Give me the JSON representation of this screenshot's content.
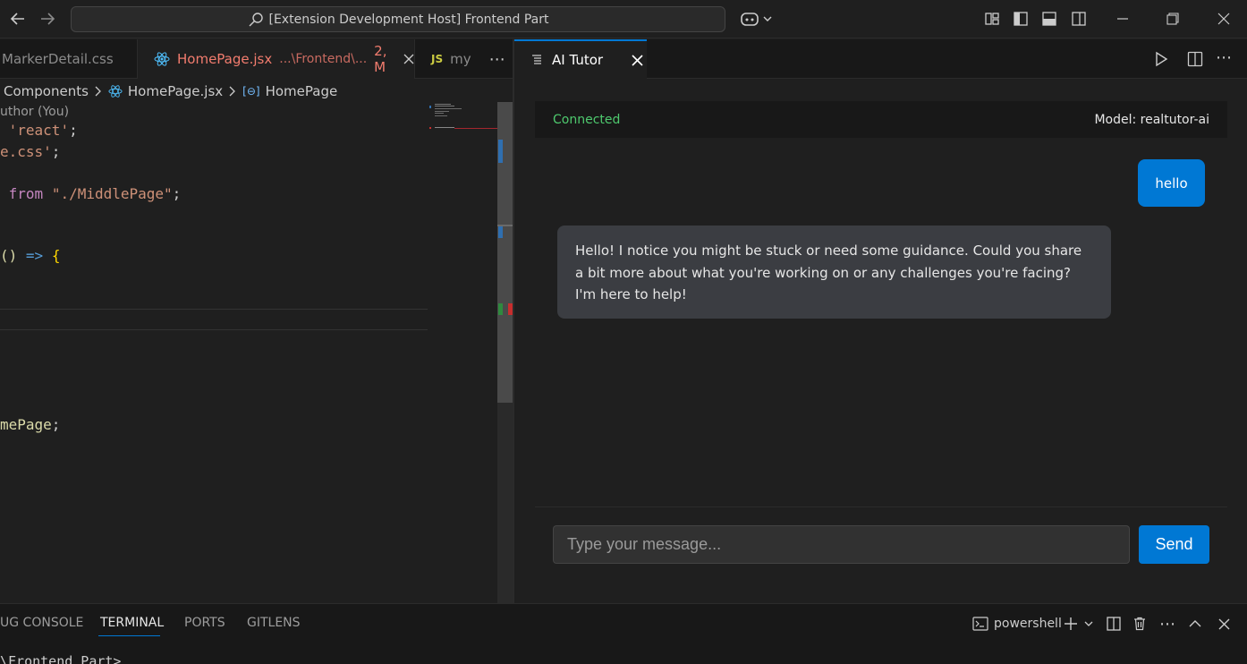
{
  "titlebar": {
    "search_text": "[Extension Development Host] Frontend Part"
  },
  "editor": {
    "tabs": [
      {
        "label": "MarkerDetail.css"
      },
      {
        "label": "HomePage.jsx",
        "path": "...\\Frontend\\...",
        "badge": "2, M"
      },
      {
        "label": "my",
        "lang_badge": "JS"
      }
    ],
    "breadcrumb": {
      "folder": "Components",
      "file": "HomePage.jsx",
      "symbol": "HomePage"
    },
    "blame": "uthor (You)",
    "code": {
      "l2_str": "'react'",
      "l2_end": ";",
      "l3_text": "e.css'",
      "l3_end": ";",
      "l5_kw": "from",
      "l5_str": "\"./MiddlePage\"",
      "l5_end": ";",
      "l8_paren": "()",
      "l8_arrow": "=>",
      "l8_brace": "{",
      "l16_text": "mePage",
      "l16_end": ";"
    }
  },
  "ai_tutor": {
    "tab_label": "AI Tutor",
    "status": "Connected",
    "model": "Model: realtutor-ai",
    "messages": {
      "user": "hello",
      "assistant": "Hello! I notice you might be stuck or need some guidance. Could you share a bit more about what you're working on or any challenges you're facing? I'm here to help!"
    },
    "input_placeholder": "Type your message...",
    "send_label": "Send"
  },
  "panel": {
    "tabs": [
      "UG CONSOLE",
      "TERMINAL",
      "PORTS",
      "GITLENS"
    ],
    "active_tab": "TERMINAL",
    "shell": "powershell",
    "terminal_line": "\\Frontend Part>"
  },
  "colors": {
    "accent": "#0078d4",
    "connected": "#4ec96e",
    "modified_tab": "#f27c6e"
  }
}
